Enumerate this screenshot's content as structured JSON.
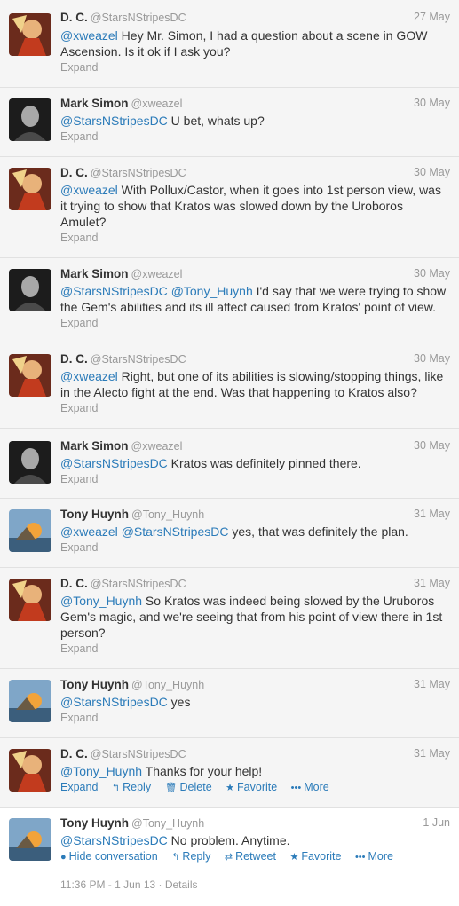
{
  "colors": {
    "link": "#2b7bb9",
    "meta": "#999999",
    "text": "#333333"
  },
  "tweets": [
    {
      "name": "D. C.",
      "handle": "@StarsNStripesDC",
      "time": "27 May",
      "mention": "@xweazel",
      "lines": [
        " Hey Mr. Simon, I had a question about a scene in GOW",
        "Ascension. Is it ok if I ask you?"
      ],
      "expand": "Expand",
      "avatar": "dc-avatar"
    },
    {
      "name": "Mark Simon",
      "handle": "@xweazel",
      "time": "30 May",
      "mention": "@StarsNStripesDC",
      "lines": [
        " U bet, whats up?"
      ],
      "expand": "Expand",
      "avatar": "mark-avatar"
    },
    {
      "name": "D. C.",
      "handle": "@StarsNStripesDC",
      "time": "30 May",
      "mention": "@xweazel",
      "lines": [
        "  With Pollux/Castor, when it goes into 1st person view, was",
        "it trying to show that Kratos was slowed down by the Uroboros",
        "Amulet?"
      ],
      "expand": "Expand",
      "avatar": "dc-avatar"
    },
    {
      "name": "Mark Simon",
      "handle": "@xweazel",
      "time": "30 May",
      "mention": "@StarsNStripesDC",
      "mention2": "@Tony_Huynh",
      "lines": [
        " I'd say that we were trying to show",
        "the Gem's abilities and its ill affect caused from Kratos' point of view."
      ],
      "expand": "Expand",
      "avatar": "mark-avatar"
    },
    {
      "name": "D. C.",
      "handle": "@StarsNStripesDC",
      "time": "30 May",
      "mention": "@xweazel",
      "lines": [
        " Right, but one of its abilities is slowing/stopping things, like",
        "in the Alecto fight at the end. Was that happening to Kratos also?"
      ],
      "expand": "Expand",
      "avatar": "dc-avatar"
    },
    {
      "name": "Mark Simon",
      "handle": "@xweazel",
      "time": "30 May",
      "mention": "@StarsNStripesDC",
      "lines": [
        " Kratos was definitely pinned there."
      ],
      "expand": "Expand",
      "avatar": "mark-avatar"
    },
    {
      "name": "Tony Huynh",
      "handle": "@Tony_Huynh",
      "time": "31 May",
      "mention": "@xweazel",
      "mention2": "@StarsNStripesDC",
      "lines": [
        " yes, that was definitely the plan."
      ],
      "expand": "Expand",
      "avatar": "tony-avatar"
    },
    {
      "name": "D. C.",
      "handle": "@StarsNStripesDC",
      "time": "31 May",
      "mention": "@Tony_Huynh",
      "lines": [
        " So Kratos was indeed being slowed by the Uruboros",
        "Gem's magic, and we're seeing that from his point of view there in 1st",
        "person?"
      ],
      "expand": "Expand",
      "avatar": "dc-avatar"
    },
    {
      "name": "Tony Huynh",
      "handle": "@Tony_Huynh",
      "time": "31 May",
      "mention": "@StarsNStripesDC",
      "lines": [
        " yes"
      ],
      "expand": "Expand",
      "avatar": "tony-avatar"
    },
    {
      "name": "D. C.",
      "handle": "@StarsNStripesDC",
      "time": "31 May",
      "mention": "@Tony_Huynh",
      "lines": [
        " Thanks for your help!"
      ],
      "avatar": "dc-avatar",
      "actions": {
        "expand": "Expand",
        "reply": "Reply",
        "delete": "Delete",
        "favorite": "Favorite",
        "more": "More"
      }
    },
    {
      "name": "Tony Huynh",
      "handle": "@Tony_Huynh",
      "time": "1 Jun",
      "mention": "@StarsNStripesDC",
      "lines": [
        " No problem. Anytime."
      ],
      "avatar": "tony-avatar",
      "actions": {
        "hide": "Hide conversation",
        "reply": "Reply",
        "retweet": "Retweet",
        "favorite": "Favorite",
        "more": "More"
      },
      "details": "11:36 PM - 1 Jun 13 · Details"
    }
  ]
}
